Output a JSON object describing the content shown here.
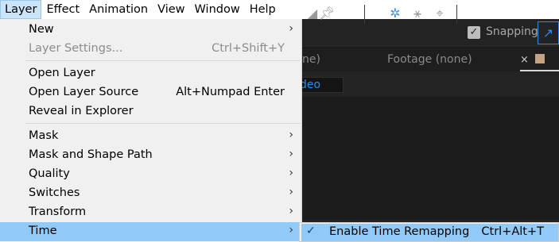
{
  "menubar": {
    "items": [
      "Layer",
      "Effect",
      "Animation",
      "View",
      "Window",
      "Help"
    ],
    "active": "Layer"
  },
  "toolbar": {
    "snapping_label": "Snapping",
    "snapping_checked": true,
    "icons": [
      "pin-tool-icon",
      "axis-mode-local-icon",
      "axis-mode-world-icon",
      "axis-mode-view-icon",
      "snap-options-icon"
    ]
  },
  "panel": {
    "comp_tab_fragment": "ne)",
    "footage_tab": "Footage  (none)",
    "close_glyph": "×",
    "field_fragment": "deo"
  },
  "menu": {
    "items": [
      {
        "label": "New",
        "shortcut": "",
        "submenu": true,
        "disabled": false
      },
      {
        "label": "Layer Settings...",
        "shortcut": "Ctrl+Shift+Y",
        "submenu": false,
        "disabled": true
      },
      {
        "label": "Open Layer",
        "shortcut": "",
        "submenu": false,
        "disabled": false
      },
      {
        "label": "Open Layer Source",
        "shortcut": "Alt+Numpad Enter",
        "submenu": false,
        "disabled": false
      },
      {
        "label": "Reveal in Explorer",
        "shortcut": "",
        "submenu": false,
        "disabled": false
      },
      {
        "label": "Mask",
        "shortcut": "",
        "submenu": true,
        "disabled": false
      },
      {
        "label": "Mask and Shape Path",
        "shortcut": "",
        "submenu": true,
        "disabled": false
      },
      {
        "label": "Quality",
        "shortcut": "",
        "submenu": true,
        "disabled": false
      },
      {
        "label": "Switches",
        "shortcut": "",
        "submenu": true,
        "disabled": false
      },
      {
        "label": "Transform",
        "shortcut": "",
        "submenu": true,
        "disabled": false
      },
      {
        "label": "Time",
        "shortcut": "",
        "submenu": true,
        "disabled": false,
        "highlighted": true
      }
    ]
  },
  "submenu": {
    "item": {
      "label": "Enable Time Remapping",
      "shortcut": "Ctrl+Alt+T",
      "checked": true
    }
  },
  "colors": {
    "menu_bg": "#f0f0f0",
    "highlight": "#91c9f7",
    "app_bg": "#232323",
    "accent_blue": "#2d8ceb"
  }
}
